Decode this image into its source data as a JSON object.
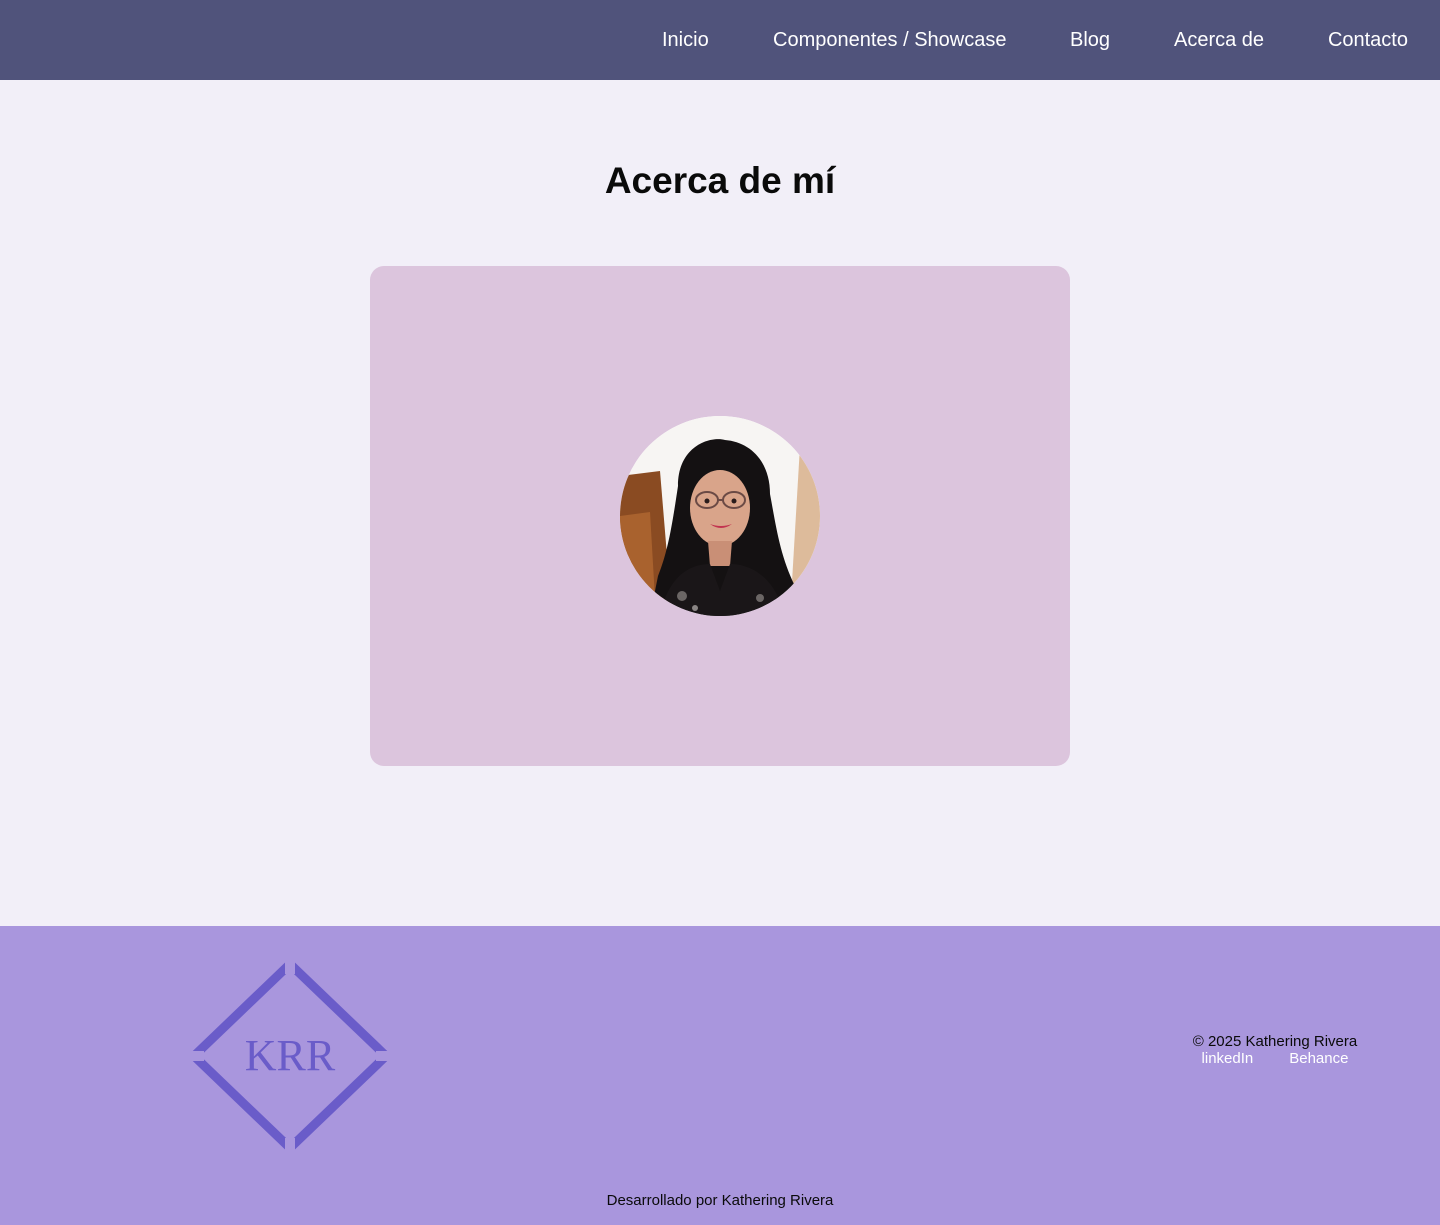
{
  "nav": {
    "links": [
      {
        "label": "Inicio"
      },
      {
        "label": "Componentes / Showcase"
      },
      {
        "label": "Blog"
      },
      {
        "label": "Acerca de"
      },
      {
        "label": "Contacto"
      }
    ]
  },
  "main": {
    "title": "Acerca de mí",
    "profile_photo": {
      "icon": "profile-photo"
    }
  },
  "footer": {
    "logo_text": "KRR",
    "copyright": "© 2025 Kathering Rivera",
    "social": [
      {
        "label": "linkedIn"
      },
      {
        "label": "Behance"
      }
    ],
    "developed_by": "Desarrollado por Kathering Rivera"
  },
  "colors": {
    "nav_bg": "#50537b",
    "page_bg": "#f2eff8",
    "card_bg": "#dcc5dd",
    "footer_bg": "#a996dd",
    "logo_color": "#6a5cc9"
  }
}
